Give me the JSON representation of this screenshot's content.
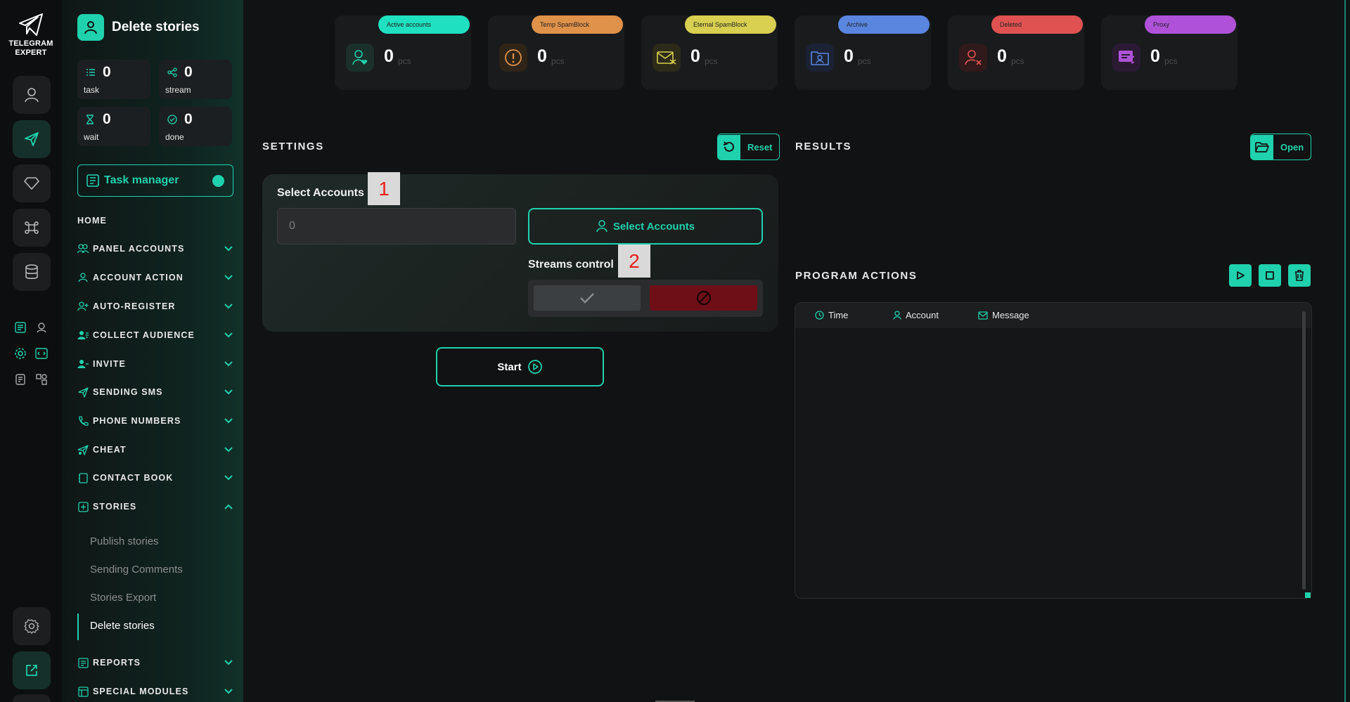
{
  "app": {
    "logo_line1": "TELEGRAM",
    "logo_line2": "EXPERT"
  },
  "sidebar": {
    "title": "Delete stories",
    "stats": [
      {
        "value": "0",
        "label": "task"
      },
      {
        "value": "0",
        "label": "stream"
      },
      {
        "value": "0",
        "label": "wait"
      },
      {
        "value": "0",
        "label": "done"
      }
    ],
    "task_manager": "Task manager",
    "home": "HOME",
    "nav": [
      "PANEL ACCOUNTS",
      "ACCOUNT ACTION",
      "AUTO-REGISTER",
      "COLLECT AUDIENCE",
      "INVITE",
      "SENDING SMS",
      "PHONE NUMBERS",
      "CHEAT",
      "CONTACT BOOK",
      "STORIES"
    ],
    "stories_sub": [
      "Publish stories",
      "Sending Comments",
      "Stories Export",
      "Delete stories"
    ],
    "nav_bottom": [
      "REPORTS",
      "SPECIAL MODULES"
    ]
  },
  "counters": [
    {
      "label": "Active accounts",
      "value": "0",
      "unit": "pcs",
      "color": "#1fe0c0"
    },
    {
      "label": "Temp SpamBlock",
      "value": "0",
      "unit": "pcs",
      "color": "#e0924a"
    },
    {
      "label": "Eternal SpamBlock",
      "value": "0",
      "unit": "pcs",
      "color": "#d9cf50"
    },
    {
      "label": "Archive",
      "value": "0",
      "unit": "pcs",
      "color": "#5a86e0"
    },
    {
      "label": "Deleted",
      "value": "0",
      "unit": "pcs",
      "color": "#e05252"
    },
    {
      "label": "Proxy",
      "value": "0",
      "unit": "pcs",
      "color": "#b052d9"
    }
  ],
  "settings": {
    "title": "SETTINGS",
    "reset": "Reset",
    "select_accounts_label": "Select Accounts",
    "accounts_placeholder": "0",
    "select_accounts_btn": "Select Accounts",
    "streams_label": "Streams control",
    "marker1": "1",
    "marker2": "2",
    "start": "Start"
  },
  "results": {
    "title": "RESULTS",
    "open": "Open"
  },
  "actions": {
    "title": "PROGRAM ACTIONS",
    "columns": [
      "Time",
      "Account",
      "Message"
    ]
  }
}
